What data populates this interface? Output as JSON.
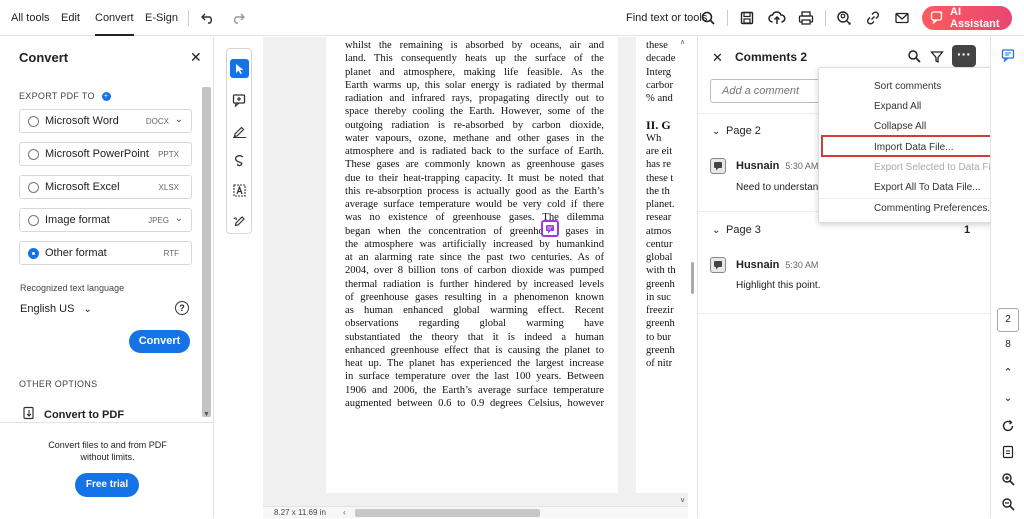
{
  "topbar": {
    "menus": [
      "All tools",
      "Edit",
      "Convert",
      "E-Sign"
    ],
    "active_menu": "Convert",
    "find_text": "Find text or tools",
    "ai_assistant": "AI Assistant"
  },
  "convert_panel": {
    "title": "Convert",
    "export_label": "EXPORT PDF TO",
    "formats": [
      {
        "label": "Microsoft Word",
        "ext": "DOCX",
        "dropdown": true
      },
      {
        "label": "Microsoft PowerPoint",
        "ext": "PPTX",
        "dropdown": false
      },
      {
        "label": "Microsoft Excel",
        "ext": "XLSX",
        "dropdown": false
      },
      {
        "label": "Image format",
        "ext": "JPEG",
        "dropdown": true
      },
      {
        "label": "Other format",
        "ext": "RTF",
        "dropdown": false
      }
    ],
    "selected_format": "Other format",
    "recognized_lang_label": "Recognized text language",
    "language": "English US",
    "convert_button": "Convert",
    "other_options_label": "OTHER OPTIONS",
    "convert_to_pdf": "Convert to PDF",
    "promo_text": "Convert files to and from PDF without limits.",
    "free_trial_button": "Free trial"
  },
  "document": {
    "page1_lines": [
      "whilst the remaining is absorbed by oceans, air and",
      "land. This consequently heats up the surface of the",
      "planet and atmosphere, making life feasible. As the",
      "Earth warms up, this solar energy is radiated by thermal",
      "radiation and infrared rays, propagating directly out to",
      "space thereby cooling the Earth. However, some of the",
      "outgoing radiation is re-absorbed by carbon dioxide,",
      "water vapours, ozone, methane and other gases in the",
      "atmosphere and is radiated back to the surface of Earth.",
      "These gases are commonly known as greenhouse gases",
      "due to their heat-trapping capacity. It must be noted that",
      "this re-absorption process is actually good as the Earth’s",
      "average surface temperature would be very cold if there",
      "was no existence of greenhouse gases. The dilemma",
      "began when the concentration of greenhouse gases in",
      "the atmosphere was artificially increased by humankind",
      "at an alarming rate since the past two centuries. As of",
      "2004, over 8 billion tons of carbon dioxide was pumped",
      "thermal radiation is further hindered by increased levels",
      "of greenhouse gases resulting in a phenomenon known",
      "as human enhanced global warming effect. Recent",
      "observations regarding global warming have",
      "substantiated the theory that it is indeed a human",
      "enhanced greenhouse effect that is causing the planet to",
      "heat up. The planet has experienced the largest increase",
      "in surface temperature over the last 100 years. Between",
      "1906 and 2006, the Earth’s average surface temperature",
      "augmented between 0.6 to 0.9 degrees Celsius, however"
    ],
    "page2_lines": [
      "these",
      "decade",
      "Interg",
      "carbor",
      "% and",
      "",
      "II. G",
      "   Wh",
      "are eit",
      "has re",
      "these t",
      "the th",
      "planet.",
      "resear",
      "atmos",
      "centur",
      "global",
      "with th",
      "greenh",
      "in suc",
      "freezir",
      "greenh",
      "to bur",
      "greenh",
      "of nitr"
    ],
    "page_size": "8.27 x 11.69 in"
  },
  "comments_panel": {
    "title": "Comments 2",
    "add_comment_placeholder": "Add a comment",
    "groups": [
      {
        "page": "Page 2",
        "count": "1",
        "author": "Husnain",
        "time": "5:30 AM",
        "text": "Need to understand this"
      },
      {
        "page": "Page 3",
        "count": "1",
        "author": "Husnain",
        "time": "5:30 AM",
        "text": "Highlight this point."
      }
    ]
  },
  "more_menu": {
    "items": [
      {
        "label": "Sort comments",
        "disabled": false,
        "submenu": true
      },
      {
        "label": "Expand All",
        "disabled": false
      },
      {
        "label": "Collapse All",
        "disabled": false
      },
      {
        "label": "Import Data File...",
        "disabled": false,
        "highlighted": true
      },
      {
        "label": "Export Selected to Data File...",
        "disabled": true
      },
      {
        "label": "Export All To Data File...",
        "disabled": false
      },
      {
        "label": "Commenting Preferences...",
        "disabled": false
      }
    ]
  },
  "right_rail": {
    "current_page": "2",
    "total_pages": "8"
  },
  "colors": {
    "accent": "#1473e6",
    "ai_button": "#ff5a5f",
    "highlight_border": "#d43b3b",
    "comment_pin": "#9b3bdb"
  }
}
